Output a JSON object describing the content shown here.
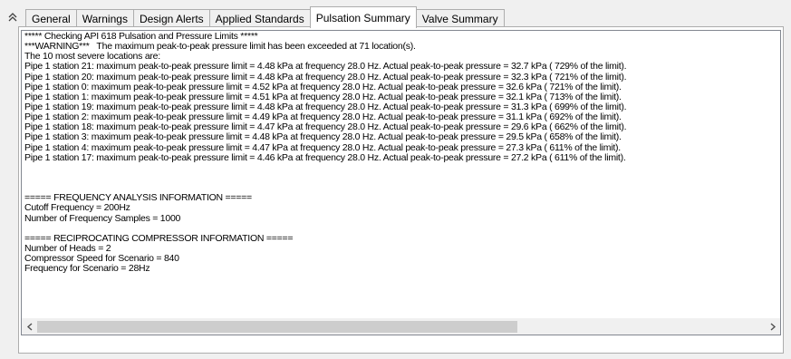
{
  "tabs": {
    "collapse_icon": "chevron-double-up",
    "items": [
      {
        "label": "General"
      },
      {
        "label": "Warnings"
      },
      {
        "label": "Design Alerts"
      },
      {
        "label": "Applied Standards"
      },
      {
        "label": "Pulsation Summary"
      },
      {
        "label": "Valve Summary"
      }
    ],
    "active_index": 4
  },
  "summary": {
    "lines": [
      "***** Checking API 618 Pulsation and Pressure Limits *****",
      "***WARNING***   The maximum peak-to-peak pressure limit has been exceeded at 71 location(s).",
      "The 10 most severe locations are:",
      "Pipe 1 station 21: maximum peak-to-peak pressure limit = 4.48 kPa at frequency 28.0 Hz. Actual peak-to-peak pressure = 32.7 kPa ( 729% of the limit).",
      "Pipe 1 station 20: maximum peak-to-peak pressure limit = 4.48 kPa at frequency 28.0 Hz. Actual peak-to-peak pressure = 32.3 kPa ( 721% of the limit).",
      "Pipe 1 station 0: maximum peak-to-peak pressure limit = 4.52 kPa at frequency 28.0 Hz. Actual peak-to-peak pressure = 32.6 kPa ( 721% of the limit).",
      "Pipe 1 station 1: maximum peak-to-peak pressure limit = 4.51 kPa at frequency 28.0 Hz. Actual peak-to-peak pressure = 32.1 kPa ( 713% of the limit).",
      "Pipe 1 station 19: maximum peak-to-peak pressure limit = 4.48 kPa at frequency 28.0 Hz. Actual peak-to-peak pressure = 31.3 kPa ( 699% of the limit).",
      "Pipe 1 station 2: maximum peak-to-peak pressure limit = 4.49 kPa at frequency 28.0 Hz. Actual peak-to-peak pressure = 31.1 kPa ( 692% of the limit).",
      "Pipe 1 station 18: maximum peak-to-peak pressure limit = 4.47 kPa at frequency 28.0 Hz. Actual peak-to-peak pressure = 29.6 kPa ( 662% of the limit).",
      "Pipe 1 station 3: maximum peak-to-peak pressure limit = 4.48 kPa at frequency 28.0 Hz. Actual peak-to-peak pressure = 29.5 kPa ( 658% of the limit).",
      "Pipe 1 station 4: maximum peak-to-peak pressure limit = 4.47 kPa at frequency 28.0 Hz. Actual peak-to-peak pressure = 27.3 kPa ( 611% of the limit).",
      "Pipe 1 station 17: maximum peak-to-peak pressure limit = 4.46 kPa at frequency 28.0 Hz. Actual peak-to-peak pressure = 27.2 kPa ( 611% of the limit).",
      "",
      "",
      "",
      "===== FREQUENCY ANALYSIS INFORMATION =====",
      "Cutoff Frequency = 200Hz",
      "Number of Frequency Samples = 1000",
      "",
      "===== RECIPROCATING COMPRESSOR INFORMATION =====",
      "Number of Heads = 2",
      "Compressor Speed for Scenario = 840",
      "Frequency for Scenario = 28Hz"
    ]
  },
  "scrollbar": {
    "left_arrow": "‹",
    "right_arrow": "›",
    "position_fraction": 0.0,
    "thumb_fraction": 0.66
  }
}
